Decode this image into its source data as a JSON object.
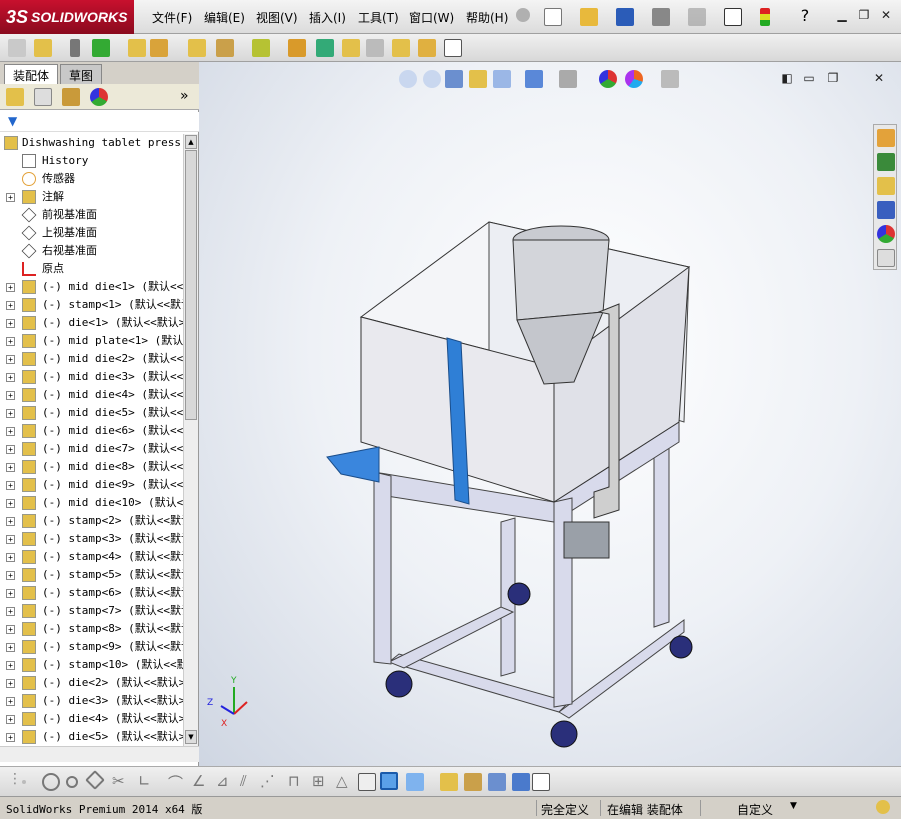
{
  "app": {
    "logo": "SOLIDWORKS",
    "logo_prefix": "3S"
  },
  "menu": {
    "items": [
      "文件(F)",
      "编辑(E)",
      "视图(V)",
      "插入(I)",
      "工具(T)",
      "窗口(W)",
      "帮助(H)"
    ]
  },
  "panel": {
    "tabs": [
      "装配体",
      "草图"
    ],
    "more_label": "»"
  },
  "tree": {
    "root": "Dishwashing tablet press",
    "items": [
      {
        "label": "History",
        "icon": "history-icon",
        "expandable": false
      },
      {
        "label": "传感器",
        "icon": "sensor-icon",
        "expandable": false
      },
      {
        "label": "注解",
        "icon": "annotation-icon",
        "expandable": true
      },
      {
        "label": "前视基准面",
        "icon": "plane-icon",
        "expandable": false
      },
      {
        "label": "上视基准面",
        "icon": "plane-icon",
        "expandable": false
      },
      {
        "label": "右视基准面",
        "icon": "plane-icon",
        "expandable": false
      },
      {
        "label": "原点",
        "icon": "origin-icon",
        "expandable": false
      },
      {
        "label": "(-) mid die<1> (默认<<默",
        "icon": "part-icon",
        "expandable": true
      },
      {
        "label": "(-) stamp<1> (默认<<默认",
        "icon": "part-icon",
        "expandable": true
      },
      {
        "label": "(-) die<1> (默认<<默认>",
        "icon": "part-icon",
        "expandable": true
      },
      {
        "label": "(-) mid plate<1> (默认<",
        "icon": "part-icon",
        "expandable": true
      },
      {
        "label": "(-) mid die<2> (默认<<默",
        "icon": "part-icon",
        "expandable": true
      },
      {
        "label": "(-) mid die<3> (默认<<默",
        "icon": "part-icon",
        "expandable": true
      },
      {
        "label": "(-) mid die<4> (默认<<默",
        "icon": "part-icon",
        "expandable": true
      },
      {
        "label": "(-) mid die<5> (默认<<默",
        "icon": "part-icon",
        "expandable": true
      },
      {
        "label": "(-) mid die<6> (默认<<默",
        "icon": "part-icon",
        "expandable": true
      },
      {
        "label": "(-) mid die<7> (默认<<默",
        "icon": "part-icon",
        "expandable": true
      },
      {
        "label": "(-) mid die<8> (默认<<默",
        "icon": "part-icon",
        "expandable": true
      },
      {
        "label": "(-) mid die<9> (默认<<默",
        "icon": "part-icon",
        "expandable": true
      },
      {
        "label": "(-) mid die<10> (默认<<",
        "icon": "part-icon",
        "expandable": true
      },
      {
        "label": "(-) stamp<2> (默认<<默认",
        "icon": "part-icon",
        "expandable": true
      },
      {
        "label": "(-) stamp<3> (默认<<默认",
        "icon": "part-icon",
        "expandable": true
      },
      {
        "label": "(-) stamp<4> (默认<<默认",
        "icon": "part-icon",
        "expandable": true
      },
      {
        "label": "(-) stamp<5> (默认<<默认",
        "icon": "part-icon",
        "expandable": true
      },
      {
        "label": "(-) stamp<6> (默认<<默认",
        "icon": "part-icon",
        "expandable": true
      },
      {
        "label": "(-) stamp<7> (默认<<默认",
        "icon": "part-icon",
        "expandable": true
      },
      {
        "label": "(-) stamp<8> (默认<<默认",
        "icon": "part-icon",
        "expandable": true
      },
      {
        "label": "(-) stamp<9> (默认<<默认",
        "icon": "part-icon",
        "expandable": true
      },
      {
        "label": "(-) stamp<10> (默认<<默",
        "icon": "part-icon",
        "expandable": true
      },
      {
        "label": "(-) die<2> (默认<<默认>",
        "icon": "part-icon",
        "expandable": true
      },
      {
        "label": "(-) die<3> (默认<<默认>",
        "icon": "part-icon",
        "expandable": true
      },
      {
        "label": "(-) die<4> (默认<<默认>",
        "icon": "part-icon",
        "expandable": true
      },
      {
        "label": "(-) die<5> (默认<<默认>",
        "icon": "part-icon",
        "expandable": true
      }
    ]
  },
  "triad": {
    "x": "X",
    "y": "Y",
    "z": "Z"
  },
  "status": {
    "version": "SolidWorks Premium 2014 x64 版",
    "constraint": "完全定义",
    "mode": "在编辑 装配体",
    "units": "自定义"
  },
  "colors": {
    "accent_blue": "#2f7fd6",
    "frame_lavender": "#d9dcef",
    "logo_red": "#c8102e"
  }
}
